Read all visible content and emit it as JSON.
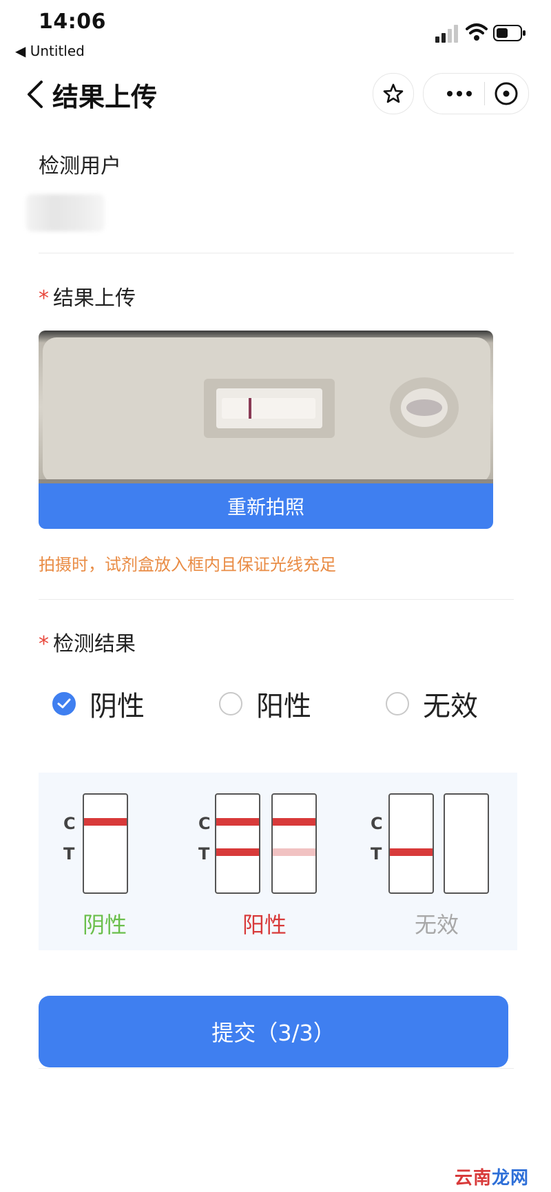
{
  "status_bar": {
    "time": "14:06",
    "back_app": "◀ Untitled"
  },
  "nav": {
    "title": "结果上传"
  },
  "user_section": {
    "label": "检测用户"
  },
  "upload_section": {
    "label": "结果上传",
    "required_mark": "*",
    "retake_label": "重新拍照",
    "tip": "拍摄时，试剂盒放入框内且保证光线充足"
  },
  "result_section": {
    "label": "检测结果",
    "required_mark": "*",
    "options": [
      {
        "label": "阴性",
        "checked": true
      },
      {
        "label": "阳性",
        "checked": false
      },
      {
        "label": "无效",
        "checked": false
      }
    ]
  },
  "guide": {
    "c_label": "C",
    "t_label": "T",
    "items": [
      {
        "label": "阴性",
        "color": "#6abf4b"
      },
      {
        "label": "阳性",
        "color": "#d83a3a"
      },
      {
        "label": "无效",
        "color": "#a8a8a8"
      }
    ]
  },
  "submit": {
    "label": "提交（3/3）"
  },
  "watermark": {
    "part1": "云南",
    "part2": "龙网"
  },
  "colors": {
    "primary": "#3f7ff0",
    "required": "#e8463a",
    "tip": "#e98c45"
  }
}
